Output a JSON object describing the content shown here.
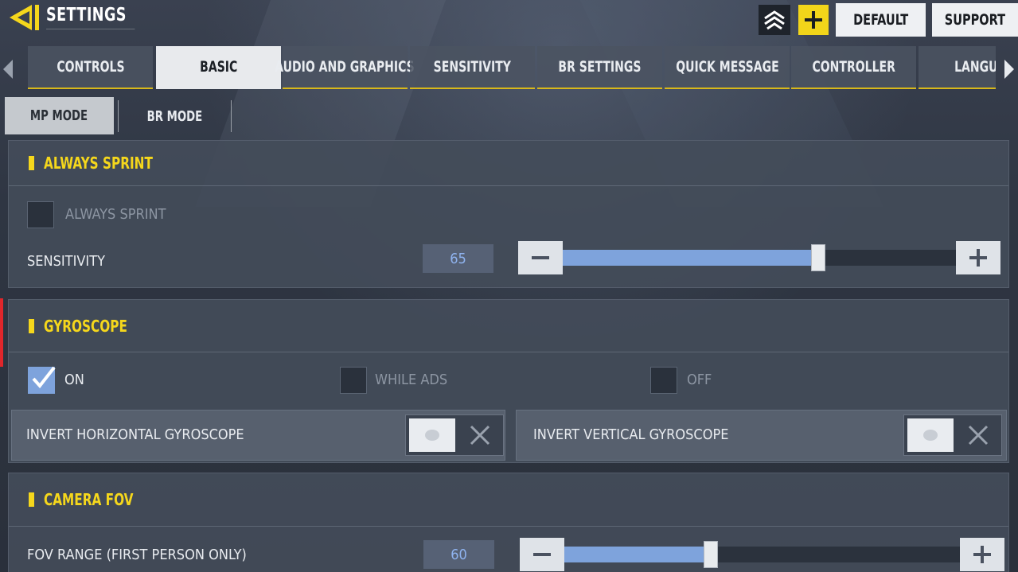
{
  "header": {
    "title": "SETTINGS",
    "default_label": "DEFAULT",
    "support_label": "SUPPORT"
  },
  "tabs": [
    {
      "label": "CONTROLS"
    },
    {
      "label": "BASIC"
    },
    {
      "label": "AUDIO AND GRAPHICS"
    },
    {
      "label": "SENSITIVITY"
    },
    {
      "label": "BR SETTINGS"
    },
    {
      "label": "QUICK MESSAGE"
    },
    {
      "label": "CONTROLLER"
    },
    {
      "label": "LANGUA"
    }
  ],
  "active_tab": "BASIC",
  "modes": {
    "mp": "MP MODE",
    "br": "BR MODE"
  },
  "always_sprint": {
    "title": "ALWAYS SPRINT",
    "checkbox_label": "ALWAYS SPRINT",
    "checked": false,
    "sensitivity_label": "SENSITIVITY",
    "sensitivity_value": "65",
    "slider_fraction": 0.65
  },
  "gyroscope": {
    "title": "GYROSCOPE",
    "options": [
      {
        "label": "ON",
        "checked": true
      },
      {
        "label": "WHILE ADS",
        "checked": false
      },
      {
        "label": "OFF",
        "checked": false
      }
    ],
    "invert_horizontal_label": "INVERT HORIZONTAL GYROSCOPE",
    "invert_vertical_label": "INVERT VERTICAL GYROSCOPE"
  },
  "camera_fov": {
    "title": "CAMERA FOV",
    "range_label": "FOV RANGE (FIRST PERSON ONLY)",
    "value": "60",
    "slider_fraction": 0.37
  },
  "colors": {
    "accent_yellow": "#f5d71c",
    "slider_blue": "#7ea3dc",
    "panel": "#444c5a"
  }
}
